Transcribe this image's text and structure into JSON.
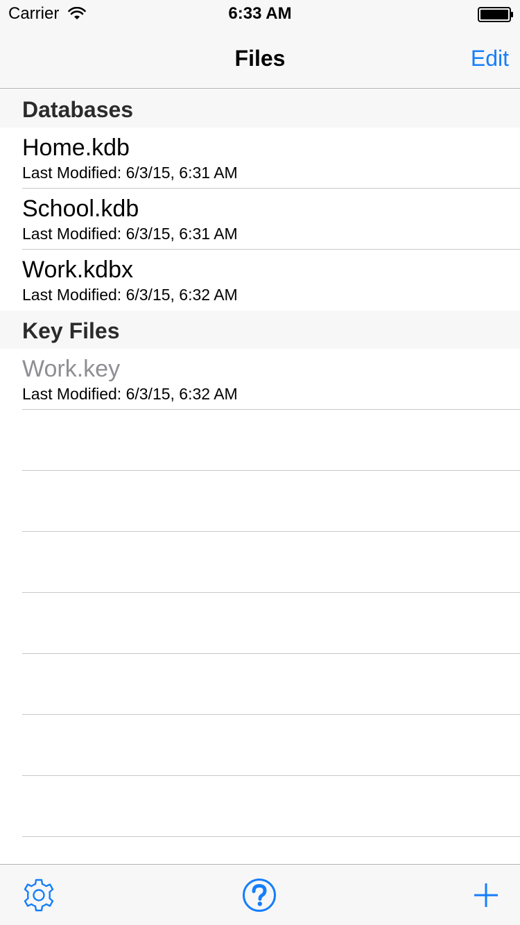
{
  "status_bar": {
    "carrier": "Carrier",
    "time": "6:33 AM"
  },
  "nav": {
    "title": "Files",
    "edit_label": "Edit"
  },
  "sections": {
    "databases": {
      "header": "Databases",
      "items": [
        {
          "name": "Home.kdb",
          "modified": "Last Modified: 6/3/15, 6:31 AM"
        },
        {
          "name": "School.kdb",
          "modified": "Last Modified: 6/3/15, 6:31 AM"
        },
        {
          "name": "Work.kdbx",
          "modified": "Last Modified: 6/3/15, 6:32 AM"
        }
      ]
    },
    "key_files": {
      "header": "Key Files",
      "items": [
        {
          "name": "Work.key",
          "modified": "Last Modified: 6/3/15, 6:32 AM"
        }
      ]
    }
  },
  "toolbar": {
    "icons": [
      "gear-icon",
      "help-icon",
      "plus-icon"
    ]
  },
  "colors": {
    "accent": "#157efb",
    "bar_background": "#f7f7f7",
    "dimmed_text": "#8e8e93"
  }
}
